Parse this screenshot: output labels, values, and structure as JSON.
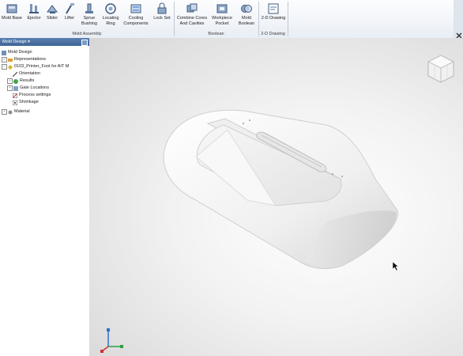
{
  "ribbon": {
    "groups": [
      {
        "label": "Mold Assembly"
      },
      {
        "label": "Boolean"
      },
      {
        "label": "2-D Drawing"
      }
    ],
    "buttons": [
      {
        "label": "Mold Base",
        "icon": "mold-base-icon"
      },
      {
        "label": "Ejector",
        "icon": "ejector-icon"
      },
      {
        "label": "Slider",
        "icon": "slider-icon"
      },
      {
        "label": "Lifter",
        "icon": "lifter-icon"
      },
      {
        "label": "Sprue\nBushing",
        "icon": "sprue-bushing-icon"
      },
      {
        "label": "Locating\nRing",
        "icon": "locating-ring-icon"
      },
      {
        "label": "Cooling\nComponents",
        "icon": "cooling-components-icon"
      },
      {
        "label": "Lock Set",
        "icon": "lock-set-icon"
      },
      {
        "label": "Combine Cores\nAnd Cavities",
        "icon": "combine-cores-icon"
      },
      {
        "label": "Workpiece\nPocket",
        "icon": "workpiece-pocket-icon"
      },
      {
        "label": "Mold\nBoolean",
        "icon": "mold-boolean-icon"
      },
      {
        "label": "2-D Drawing",
        "icon": "2d-drawing-icon"
      }
    ]
  },
  "browser": {
    "title": "Mold Design ▾",
    "tree": [
      {
        "label": "Mold Design"
      },
      {
        "label": "Representations"
      },
      {
        "label": "0103_Printer_Foot for AIT M"
      },
      {
        "label": "Orientation"
      },
      {
        "label": "Results"
      },
      {
        "label": "Gate Locations"
      },
      {
        "label": "Process settings"
      },
      {
        "label": "Shrinkage"
      },
      {
        "label": "Material"
      }
    ]
  },
  "colors": {
    "ribbon_bg": "#eef2f7",
    "browser_header": "#4a6fa3",
    "viewport_bg": "#e4e4e4"
  }
}
